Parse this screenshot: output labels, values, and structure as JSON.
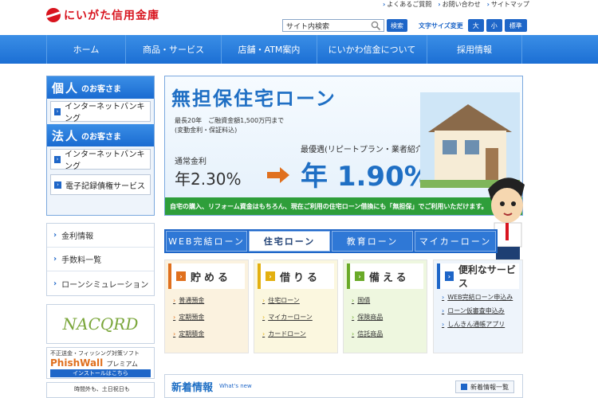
{
  "header": {
    "logo_text": "にいがた信用金庫",
    "top_links": [
      "よくあるご質問",
      "お問い合わせ",
      "サイトマップ"
    ],
    "search_placeholder": "サイト内検索",
    "search_button": "検索",
    "font_size_label": "文字サイズ変更",
    "font_size_buttons": [
      "大",
      "小",
      "標準"
    ]
  },
  "nav": {
    "items": [
      "ホーム",
      "商品・サービス",
      "店舗・ATM案内",
      "にいかわ信金について",
      "採用情報"
    ]
  },
  "sidebar": {
    "personal_big": "個人",
    "personal_small": "のお客さま",
    "personal_button": "インターネットバンキング",
    "corporate_big": "法人",
    "corporate_small": "のお客さま",
    "corporate_button": "インターネットバンキング",
    "densai_button": "電子記録債権サービス",
    "links": [
      "金利情報",
      "手数料一覧",
      "ローンシミュレーション"
    ],
    "nacqrd": "NACQRD",
    "phishwall_line1": "不正送金・フィッシング対策ソフト",
    "phishwall_title": "PhishWall",
    "phishwall_suffix": "プレミアム",
    "phishwall_install": "インストールはこちら",
    "bottom_text": "時間外も、土日祝日も"
  },
  "banner": {
    "title": "無担保住宅ローン",
    "conditions_line1": "最長20年　ご融資金額1,500万円まで",
    "conditions_line2": "(変動金利・保証料込)",
    "normal_label": "通常金利",
    "normal_rate": "年2.30%",
    "best_label": "最優遇(リピートプラン・業者紹介の場合)",
    "best_rate": "年 1.90%",
    "strip_text": "自宅の購入、リフォーム資金はもちろん、現在ご利用の住宅ローン借換にも「無担保」でご利用いただけます。"
  },
  "loan_tabs": [
    "WEB完結ローン",
    "住宅ローン",
    "教育ローン",
    "マイカーローン"
  ],
  "categories": {
    "save": {
      "title": "貯める",
      "items": [
        "普通預金",
        "定期預金",
        "定期積金"
      ]
    },
    "borrow": {
      "title": "借りる",
      "items": [
        "住宅ローン",
        "マイカーローン",
        "カードローン"
      ]
    },
    "grow": {
      "title": "備える",
      "items": [
        "国債",
        "保険商品",
        "信託商品"
      ]
    },
    "services": {
      "title": "便利なサービス",
      "items": [
        "WEB完結ローン申込み",
        "ローン仮審査申込み",
        "しんきん通帳アプリ"
      ]
    }
  },
  "news": {
    "title": "新着情報",
    "subtitle": "What's new",
    "list_button": "新着情報一覧"
  },
  "colors": {
    "brand_red": "#d8141e",
    "brand_blue": "#1e66c8",
    "green": "#2e9e3a",
    "orange": "#e0701e"
  }
}
